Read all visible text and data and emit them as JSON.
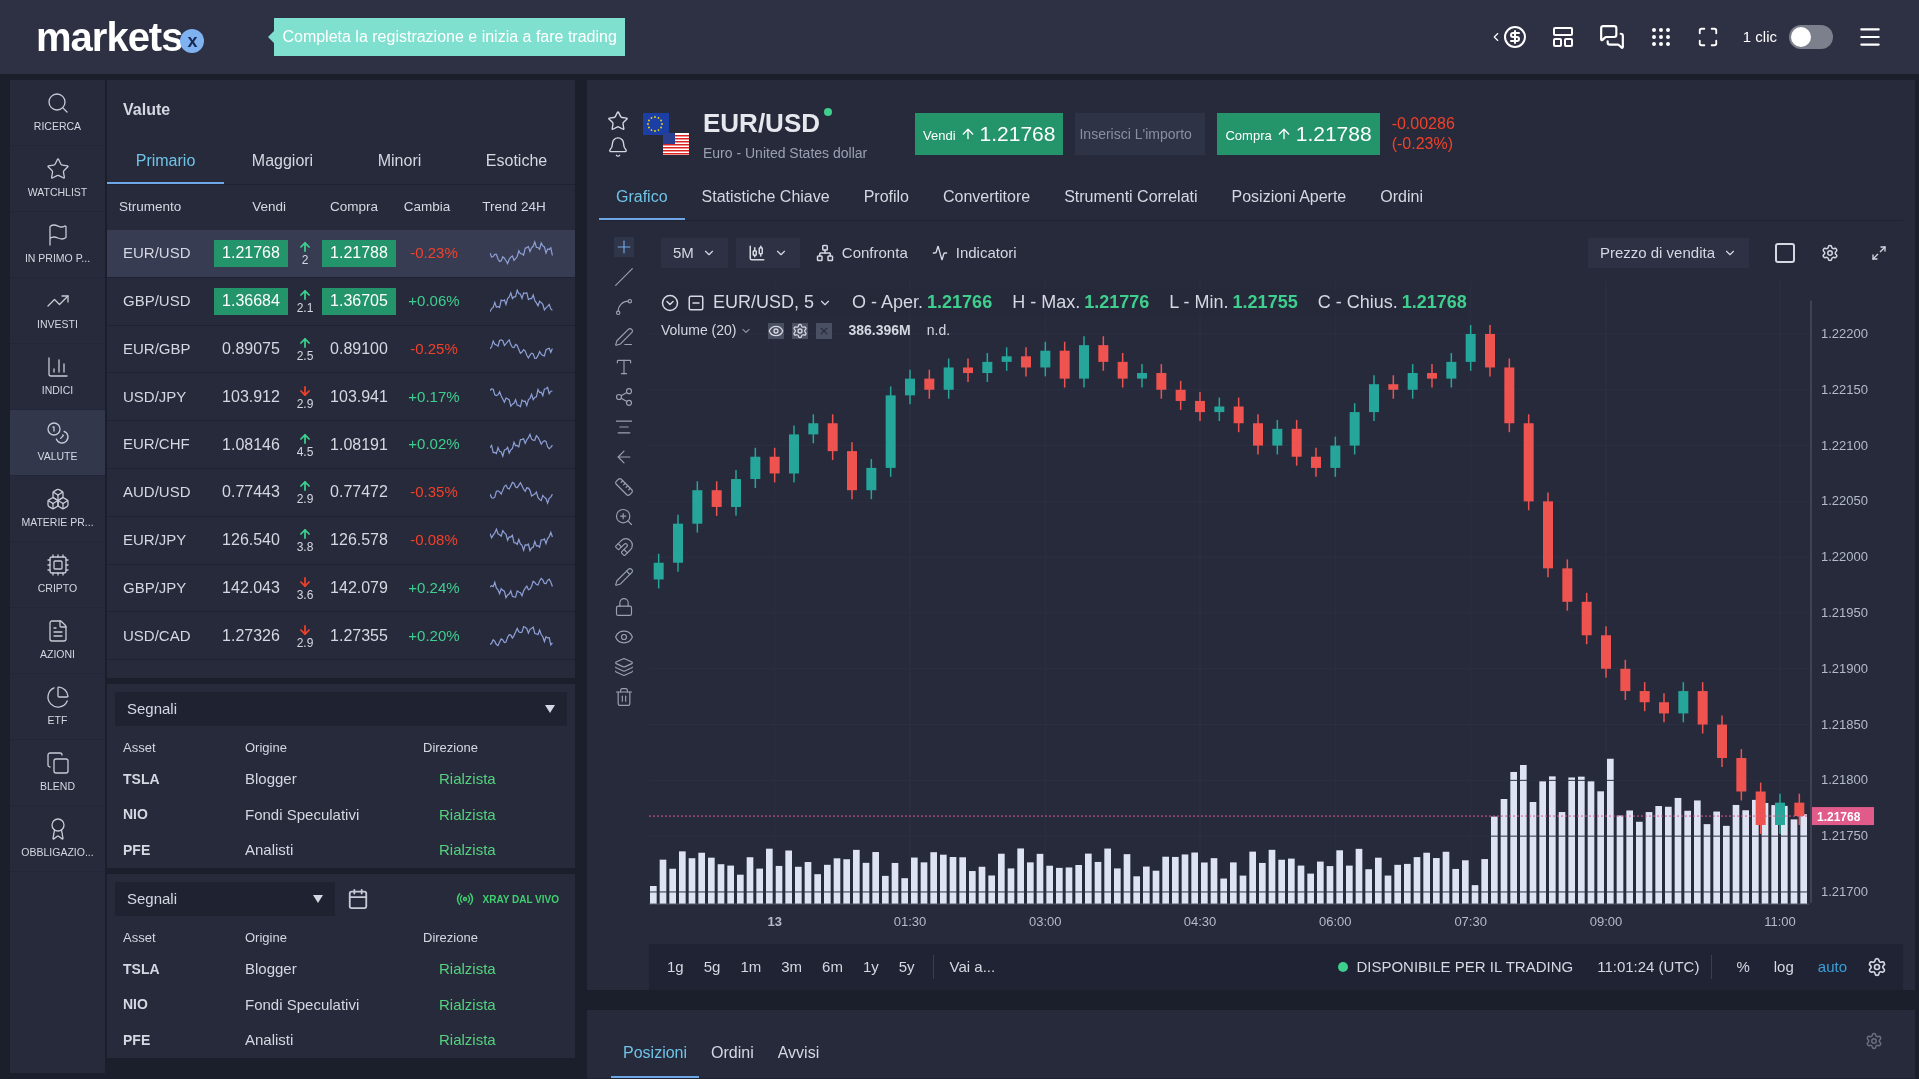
{
  "header": {
    "logo": "markets",
    "logo_mark": "x",
    "promo": "Completa la registrazione e inizia a fare trading",
    "one_click": {
      "label": "1 clic",
      "on": false
    }
  },
  "nav": [
    {
      "label": "RICERCA",
      "selected": false
    },
    {
      "label": "WATCHLIST",
      "selected": false
    },
    {
      "label": "IN PRIMO P...",
      "selected": false
    },
    {
      "label": "INVESTI",
      "selected": false
    },
    {
      "label": "INDICI",
      "selected": false
    },
    {
      "label": "VALUTE",
      "selected": true
    },
    {
      "label": "MATERIE PR...",
      "selected": false
    },
    {
      "label": "CRIPTO",
      "selected": false
    },
    {
      "label": "AZIONI",
      "selected": false
    },
    {
      "label": "ETF",
      "selected": false
    },
    {
      "label": "BLEND",
      "selected": false
    },
    {
      "label": "OBBLIGAZIO...",
      "selected": false
    }
  ],
  "watchlist": {
    "title": "Valute",
    "tabs": [
      {
        "label": "Primario",
        "selected": true
      },
      {
        "label": "Maggiori",
        "selected": false
      },
      {
        "label": "Minori",
        "selected": false
      },
      {
        "label": "Esotiche",
        "selected": false
      }
    ],
    "columns": [
      "Strumento",
      "Vendi",
      "Compra",
      "Cambia",
      "Trend 24H"
    ],
    "rows": [
      {
        "symbol": "EUR/USD",
        "sell": "1.21768",
        "spread": "2",
        "spread_up": true,
        "buy": "1.21788",
        "change": "-0.23%",
        "change_up": false,
        "flash": true,
        "selected": true
      },
      {
        "symbol": "GBP/USD",
        "sell": "1.36684",
        "spread": "2.1",
        "spread_up": true,
        "buy": "1.36705",
        "change": "+0.06%",
        "change_up": true,
        "flash": true,
        "selected": false
      },
      {
        "symbol": "EUR/GBP",
        "sell": "0.89075",
        "spread": "2.5",
        "spread_up": true,
        "buy": "0.89100",
        "change": "-0.25%",
        "change_up": false,
        "flash": false,
        "selected": false
      },
      {
        "symbol": "USD/JPY",
        "sell": "103.912",
        "spread": "2.9",
        "spread_up": false,
        "buy": "103.941",
        "change": "+0.17%",
        "change_up": true,
        "flash": false,
        "selected": false
      },
      {
        "symbol": "EUR/CHF",
        "sell": "1.08146",
        "spread": "4.5",
        "spread_up": true,
        "buy": "1.08191",
        "change": "+0.02%",
        "change_up": true,
        "flash": false,
        "selected": false
      },
      {
        "symbol": "AUD/USD",
        "sell": "0.77443",
        "spread": "2.9",
        "spread_up": true,
        "buy": "0.77472",
        "change": "-0.35%",
        "change_up": false,
        "flash": false,
        "selected": false
      },
      {
        "symbol": "EUR/JPY",
        "sell": "126.540",
        "spread": "3.8",
        "spread_up": true,
        "buy": "126.578",
        "change": "-0.08%",
        "change_up": false,
        "flash": false,
        "selected": false
      },
      {
        "symbol": "GBP/JPY",
        "sell": "142.043",
        "spread": "3.6",
        "spread_up": false,
        "buy": "142.079",
        "change": "+0.24%",
        "change_up": true,
        "flash": false,
        "selected": false
      },
      {
        "symbol": "USD/CAD",
        "sell": "1.27326",
        "spread": "2.9",
        "spread_up": false,
        "buy": "1.27355",
        "change": "+0.20%",
        "change_up": true,
        "flash": false,
        "selected": false
      }
    ]
  },
  "signals": [
    {
      "dropdown": "Segnali",
      "columns": [
        "Asset",
        "Origine",
        "Direzione"
      ],
      "rows": [
        {
          "asset": "TSLA",
          "origin": "Blogger",
          "direction": "Rialzista"
        },
        {
          "asset": "NIO",
          "origin": "Fondi Speculativi",
          "direction": "Rialzista"
        },
        {
          "asset": "PFE",
          "origin": "Analisti",
          "direction": "Rialzista"
        }
      ]
    },
    {
      "dropdown": "Segnali",
      "live": "XRAY DAL VIVO",
      "columns": [
        "Asset",
        "Origine",
        "Direzione"
      ],
      "rows": [
        {
          "asset": "TSLA",
          "origin": "Blogger",
          "direction": "Rialzista"
        },
        {
          "asset": "NIO",
          "origin": "Fondi Speculativi",
          "direction": "Rialzista"
        },
        {
          "asset": "PFE",
          "origin": "Analisti",
          "direction": "Rialzista"
        }
      ]
    }
  ],
  "instrument": {
    "symbol": "EUR/USD",
    "online": true,
    "name": "Euro - United States dollar",
    "sell_label": "Vendi",
    "sell_up": true,
    "sell": "1.21768",
    "amount_placeholder": "Inserisci L'importo",
    "buy_label": "Compra",
    "buy_up": true,
    "buy": "1.21788",
    "change": "-0.00286",
    "change_pct": "(-0.23%)"
  },
  "chart_tabs": [
    {
      "label": "Grafico",
      "selected": true
    },
    {
      "label": "Statistiche Chiave",
      "selected": false
    },
    {
      "label": "Profilo",
      "selected": false
    },
    {
      "label": "Convertitore",
      "selected": false
    },
    {
      "label": "Strumenti Correlati",
      "selected": false
    },
    {
      "label": "Posizioni Aperte",
      "selected": false
    },
    {
      "label": "Ordini",
      "selected": false
    }
  ],
  "toolbar": {
    "interval": "5M",
    "compare": "Confronta",
    "indicators": "Indicatori",
    "price_type": "Prezzo di vendita"
  },
  "legend": {
    "title": "EUR/USD, 5",
    "ohlc": [
      {
        "label": "O - Aper.",
        "value": "1.21766"
      },
      {
        "label": "H - Max.",
        "value": "1.21776"
      },
      {
        "label": "L - Min.",
        "value": "1.21755"
      },
      {
        "label": "C - Chius.",
        "value": "1.21768"
      }
    ],
    "volume_label": "Volume (20)",
    "volume_value": "386.396M",
    "volume_note": "n.d."
  },
  "chart_data": {
    "type": "candlestick",
    "ylim": [
      1.2169,
      1.2223
    ],
    "grid": true,
    "categories": [
      null,
      null,
      null,
      null,
      null,
      null,
      "13",
      null,
      null,
      null,
      null,
      null,
      null,
      "01:30",
      null,
      null,
      null,
      null,
      null,
      null,
      "03:00",
      null,
      null,
      null,
      null,
      null,
      null,
      null,
      "04:30",
      null,
      null,
      null,
      null,
      null,
      null,
      "06:00",
      null,
      null,
      null,
      null,
      null,
      null,
      "07:30",
      null,
      null,
      null,
      null,
      null,
      null,
      "09:00",
      null,
      null,
      null,
      null,
      null,
      null,
      null,
      null,
      "11:00",
      null
    ],
    "ohlc": [
      [
        1.2198,
        1.22003,
        1.21972,
        1.21995
      ],
      [
        1.21995,
        1.22038,
        1.21987,
        1.2203
      ],
      [
        1.2203,
        1.22068,
        1.22022,
        1.2206
      ],
      [
        1.2206,
        1.22068,
        1.22037,
        1.22045
      ],
      [
        1.22045,
        1.22078,
        1.22037,
        1.2207
      ],
      [
        1.2207,
        1.22098,
        1.22062,
        1.2209
      ],
      [
        1.2209,
        1.22098,
        1.22067,
        1.22075
      ],
      [
        1.22075,
        1.22118,
        1.22067,
        1.2211
      ],
      [
        1.2211,
        1.22128,
        1.22102,
        1.2212
      ],
      [
        1.2212,
        1.22128,
        1.22087,
        1.22095
      ],
      [
        1.22095,
        1.22103,
        1.22052,
        1.2206
      ],
      [
        1.2206,
        1.22088,
        1.22052,
        1.2208
      ],
      [
        1.2208,
        1.22153,
        1.22072,
        1.22145
      ],
      [
        1.22145,
        1.22168,
        1.22137,
        1.2216
      ],
      [
        1.2216,
        1.22168,
        1.22142,
        1.2215
      ],
      [
        1.2215,
        1.22178,
        1.22142,
        1.2217
      ],
      [
        1.2217,
        1.22178,
        1.22157,
        1.22165
      ],
      [
        1.22165,
        1.22183,
        1.22157,
        1.22175
      ],
      [
        1.22175,
        1.22188,
        1.22167,
        1.2218
      ],
      [
        1.2218,
        1.22188,
        1.22162,
        1.2217
      ],
      [
        1.2217,
        1.22193,
        1.22162,
        1.22185
      ],
      [
        1.22185,
        1.22193,
        1.22152,
        1.2216
      ],
      [
        1.2216,
        1.22198,
        1.22152,
        1.2219
      ],
      [
        1.2219,
        1.22198,
        1.22167,
        1.22175
      ],
      [
        1.22175,
        1.22183,
        1.22152,
        1.2216
      ],
      [
        1.2216,
        1.22173,
        1.22152,
        1.22165
      ],
      [
        1.22165,
        1.22173,
        1.22142,
        1.2215
      ],
      [
        1.2215,
        1.22158,
        1.22132,
        1.2214
      ],
      [
        1.2214,
        1.22148,
        1.22122,
        1.2213
      ],
      [
        1.2213,
        1.22143,
        1.22122,
        1.22135
      ],
      [
        1.22135,
        1.22143,
        1.22112,
        1.2212
      ],
      [
        1.2212,
        1.22128,
        1.22092,
        1.221
      ],
      [
        1.221,
        1.22123,
        1.22092,
        1.22115
      ],
      [
        1.22115,
        1.22123,
        1.22082,
        1.2209
      ],
      [
        1.2209,
        1.22098,
        1.22072,
        1.2208
      ],
      [
        1.2208,
        1.22108,
        1.22072,
        1.221
      ],
      [
        1.221,
        1.22138,
        1.22092,
        1.2213
      ],
      [
        1.2213,
        1.22163,
        1.22122,
        1.22155
      ],
      [
        1.22155,
        1.22163,
        1.22142,
        1.2215
      ],
      [
        1.2215,
        1.22173,
        1.22142,
        1.22165
      ],
      [
        1.22165,
        1.22173,
        1.22152,
        1.2216
      ],
      [
        1.2216,
        1.22183,
        1.22152,
        1.22175
      ],
      [
        1.22175,
        1.22208,
        1.22167,
        1.222
      ],
      [
        1.222,
        1.22208,
        1.22162,
        1.2217
      ],
      [
        1.2217,
        1.22178,
        1.22112,
        1.2212
      ],
      [
        1.2212,
        1.22128,
        1.22042,
        1.2205
      ],
      [
        1.2205,
        1.22058,
        1.21982,
        1.2199
      ],
      [
        1.2199,
        1.21998,
        1.21952,
        1.2196
      ],
      [
        1.2196,
        1.21968,
        1.21922,
        1.2193
      ],
      [
        1.2193,
        1.21938,
        1.21892,
        1.219
      ],
      [
        1.219,
        1.21908,
        1.21872,
        1.2188
      ],
      [
        1.2188,
        1.21888,
        1.21862,
        1.2187
      ],
      [
        1.2187,
        1.21878,
        1.21852,
        1.2186
      ],
      [
        1.2186,
        1.21888,
        1.21852,
        1.2188
      ],
      [
        1.2188,
        1.21888,
        1.21842,
        1.2185
      ],
      [
        1.2185,
        1.21858,
        1.21812,
        1.2182
      ],
      [
        1.2182,
        1.21828,
        1.21782,
        1.2179
      ],
      [
        1.2179,
        1.21798,
        1.21752,
        1.2176
      ],
      [
        1.2176,
        1.21788,
        1.21752,
        1.2178
      ],
      [
        1.2178,
        1.21788,
        1.2176,
        1.21768
      ]
    ],
    "ref_lines": [
      {
        "axis": "y",
        "value": 1.21768,
        "label": "1.21768",
        "color": "#e05a8a"
      }
    ],
    "yticks": [
      {
        "value": 1.222,
        "label": "1.22200"
      },
      {
        "value": 1.2215,
        "label": "1.22150"
      },
      {
        "value": 1.221,
        "label": "1.22100"
      },
      {
        "value": 1.2205,
        "label": "1.22050"
      },
      {
        "value": 1.22,
        "label": "1.22000"
      },
      {
        "value": 1.2195,
        "label": "1.21950"
      },
      {
        "value": 1.219,
        "label": "1.21900"
      },
      {
        "value": 1.2185,
        "label": "1.21850"
      },
      {
        "value": 1.218,
        "label": "1.21800"
      },
      {
        "value": 1.2175,
        "label": "1.21750"
      },
      {
        "value": 1.217,
        "label": "1.21700"
      }
    ]
  },
  "ranges": [
    "1g",
    "5g",
    "1m",
    "3m",
    "6m",
    "1y",
    "5y"
  ],
  "goto": "Vai a...",
  "status": {
    "label": "DISPONIBILE PER IL TRADING",
    "online": true
  },
  "time": "11:01:24 (UTC)",
  "scale_options": [
    {
      "label": "%",
      "selected": false
    },
    {
      "label": "log",
      "selected": false
    },
    {
      "label": "auto",
      "selected": true
    }
  ],
  "bottom_tabs": [
    {
      "label": "Posizioni",
      "selected": true
    },
    {
      "label": "Ordini",
      "selected": false
    },
    {
      "label": "Avvisi",
      "selected": false
    }
  ]
}
